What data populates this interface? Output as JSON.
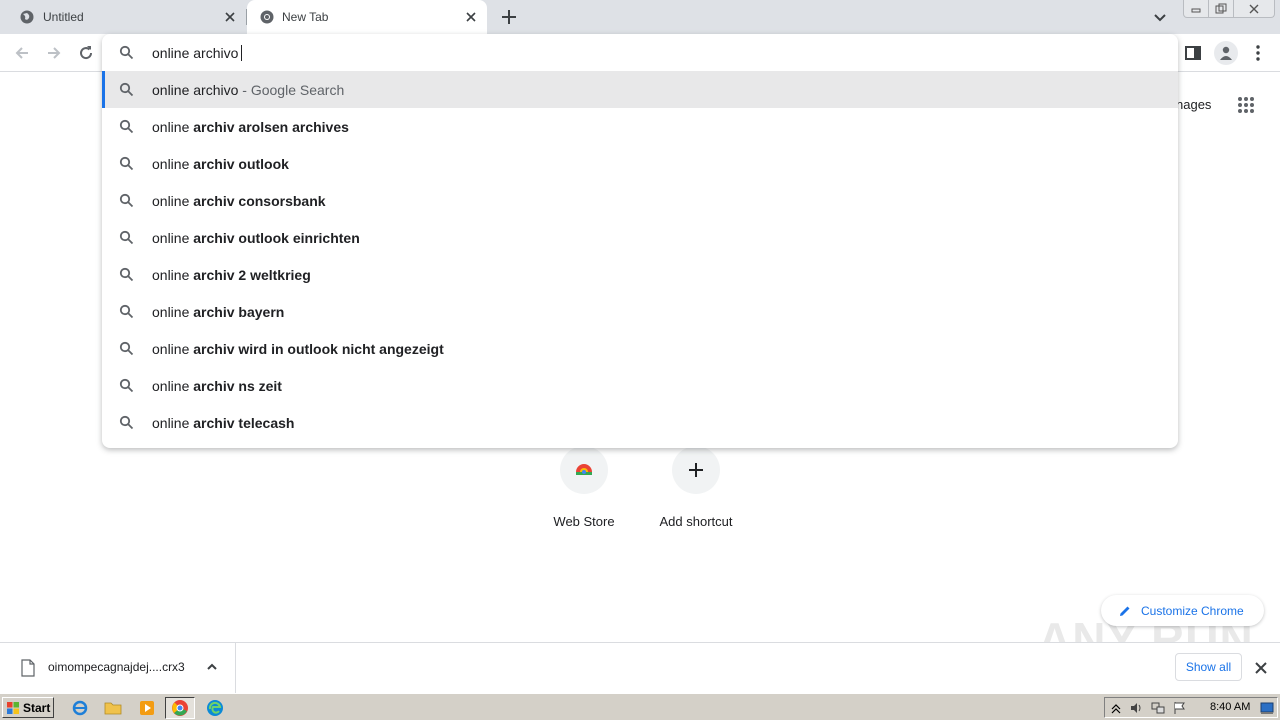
{
  "tabs": [
    {
      "title": "Untitled",
      "active": false
    },
    {
      "title": "New Tab",
      "active": true
    }
  ],
  "omnibox": {
    "query": "online archivo",
    "suggestions": [
      {
        "prefix": "online archivo",
        "bold": "",
        "suffix": " - Google Search",
        "selected": true
      },
      {
        "prefix": "online ",
        "bold": "archiv arolsen archives",
        "suffix": ""
      },
      {
        "prefix": "online ",
        "bold": "archiv outlook",
        "suffix": ""
      },
      {
        "prefix": "online ",
        "bold": "archiv consorsbank",
        "suffix": ""
      },
      {
        "prefix": "online ",
        "bold": "archiv outlook einrichten",
        "suffix": ""
      },
      {
        "prefix": "online ",
        "bold": "archiv 2 weltkrieg",
        "suffix": ""
      },
      {
        "prefix": "online ",
        "bold": "archiv bayern",
        "suffix": ""
      },
      {
        "prefix": "online ",
        "bold": "archiv wird in outlook nicht angezeigt",
        "suffix": ""
      },
      {
        "prefix": "online ",
        "bold": "archiv ns zeit",
        "suffix": ""
      },
      {
        "prefix": "online ",
        "bold": "archiv telecash",
        "suffix": ""
      }
    ]
  },
  "page": {
    "images_link": "nages",
    "shortcuts": [
      {
        "label": "Web Store"
      },
      {
        "label": "Add shortcut"
      }
    ],
    "customize_label": "Customize Chrome",
    "watermark": "ANY RUN"
  },
  "download_bar": {
    "filename": "oimompecagnajdej....crx3",
    "show_all_label": "Show all"
  },
  "taskbar": {
    "start_label": "Start",
    "clock": "8:40 AM"
  },
  "colors": {
    "accent": "#1a73e8",
    "tabstrip": "#dee1e6",
    "selected_row": "#e8e8e9",
    "taskbar": "#d4d0c8"
  }
}
